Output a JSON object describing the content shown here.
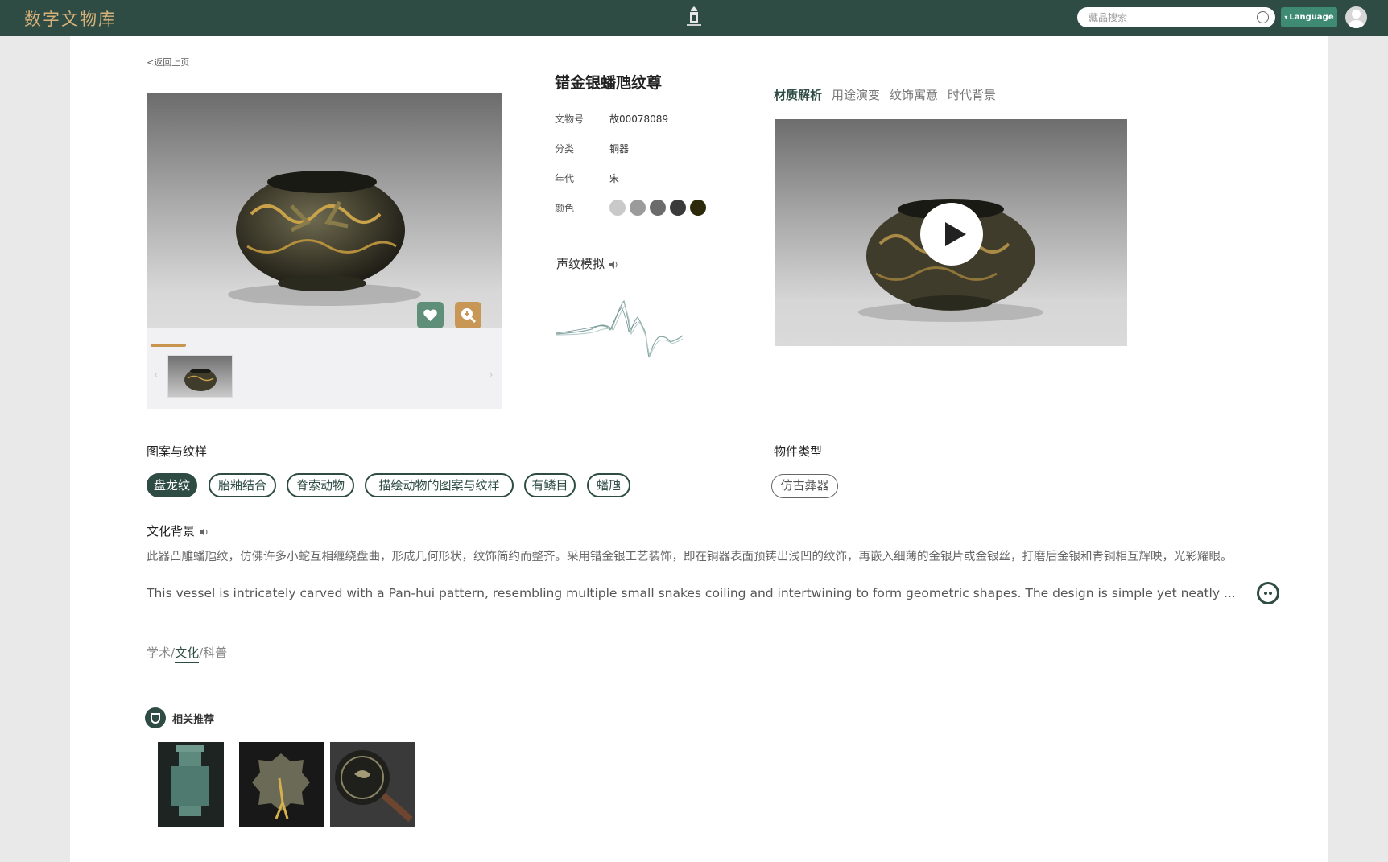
{
  "header": {
    "logo": "数字文物库",
    "search_placeholder": "藏品搜索",
    "language_label": "Language"
  },
  "back_link": "<返回上页",
  "artifact": {
    "title": "错金银蟠虺纹尊",
    "fields": [
      {
        "label": "文物号",
        "value": "故00078089"
      },
      {
        "label": "分类",
        "value": "铜器"
      },
      {
        "label": "年代",
        "value": "宋"
      },
      {
        "label": "颜色",
        "value": ""
      }
    ],
    "colors": [
      "#c9c9c9",
      "#9b9b9b",
      "#6b6b6b",
      "#3a3a3a",
      "#2c2a0a"
    ]
  },
  "voice_simulation": "声纹模拟",
  "tabs": [
    {
      "label": "材质解析",
      "active": true
    },
    {
      "label": "用途演变",
      "active": false
    },
    {
      "label": "纹饰寓意",
      "active": false
    },
    {
      "label": "时代背景",
      "active": false
    }
  ],
  "patterns": {
    "title": "图案与纹样",
    "tags": [
      "盘龙纹",
      "胎釉结合",
      "脊索动物",
      "描绘动物的图案与纹样",
      "有鳞目",
      "蟠虺"
    ]
  },
  "object_type": {
    "title": "物件类型",
    "tags": [
      "仿古彝器"
    ]
  },
  "culture": {
    "title": "文化背景",
    "desc_cn": "此器凸雕蟠虺纹，仿佛许多小蛇互相缠绕盘曲，形成几何形状，纹饰简约而整齐。采用错金银工艺装饰，即在铜器表面预铸出浅凹的纹饰，再嵌入细薄的金银片或金银丝，打磨后金银和青铜相互辉映，光彩耀眼。",
    "desc_en": "This vessel is intricately carved with a Pan-hui pattern, resembling multiple small snakes coiling and intertwining to form geometric shapes. The design is simple yet neatly ..."
  },
  "level_tabs": {
    "academic": "学术",
    "culture": "文化",
    "popular": "科普",
    "sep": "/"
  },
  "recommend": {
    "title": "相关推荐"
  }
}
